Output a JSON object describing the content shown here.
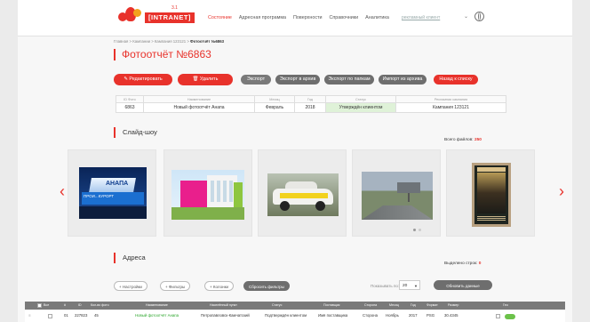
{
  "header": {
    "brand": "[INTRANET]",
    "brand_sup": "3.1",
    "nav": [
      "Состояние",
      "Адресная программа",
      "Поверхности",
      "Справочники",
      "Аналитика"
    ],
    "user": "рекламный клиент"
  },
  "breadcrumb": [
    "Главная",
    "Кампании",
    "Кампания 123121"
  ],
  "breadcrumb_current": "Фотоотчёт №6863",
  "page_title": "Фотоотчёт №6863",
  "actions": {
    "edit": "Редактировать",
    "delete": "Удалить",
    "export": "Экспорт",
    "export_archive": "Экспорт в архив",
    "export_folders": "Экспорт по папкам",
    "import_archive": "Импорт из архива",
    "back": "Назад к списку"
  },
  "info_table": {
    "headers": [
      "ID Фото",
      "Наименование",
      "Месяц",
      "Год",
      "Статус",
      "Рекламная кампания"
    ],
    "row": [
      "6863",
      "Новый фотоотчёт Анапа",
      "Февраль",
      "2018",
      "Утверждён клиентом",
      "Кампания 123121"
    ]
  },
  "slideshow": {
    "title": "Слайд-шоу",
    "total_label": "Всего файлов:",
    "total_value": "250",
    "photo1_text": "АНАПА",
    "photo1_sub": "ПРОИ...КУРОРТ",
    "prev_arrow": "‹",
    "next_arrow": "›"
  },
  "addresses": {
    "title": "Адреса",
    "selected_label": "Выделено строк:",
    "selected_value": "0",
    "filters": [
      "+ Настройки",
      "+ Фильтры",
      "+ Колонки"
    ],
    "reset_filters": "Сбросить фильтры",
    "perpage_label": "Показывать по:",
    "perpage_value": "20",
    "refresh": "Обновить данные",
    "columns": [
      "Все",
      "#",
      "ID",
      "Кол-во фото",
      "Наименование",
      "Населённый пункт",
      "Статус",
      "Поставщик",
      "Сторона",
      "Месяц",
      "Год",
      "Формат",
      "Размер",
      "Гео"
    ],
    "row": [
      "01",
      "227823",
      "45",
      "Новый фотоотчёт Анапа",
      "Петропавловск-Камчатский",
      "Подтверждён клиентом",
      "Имя поставщика",
      "Сторона",
      "Ноябрь",
      "2017",
      "PSG",
      "30.4345"
    ]
  }
}
